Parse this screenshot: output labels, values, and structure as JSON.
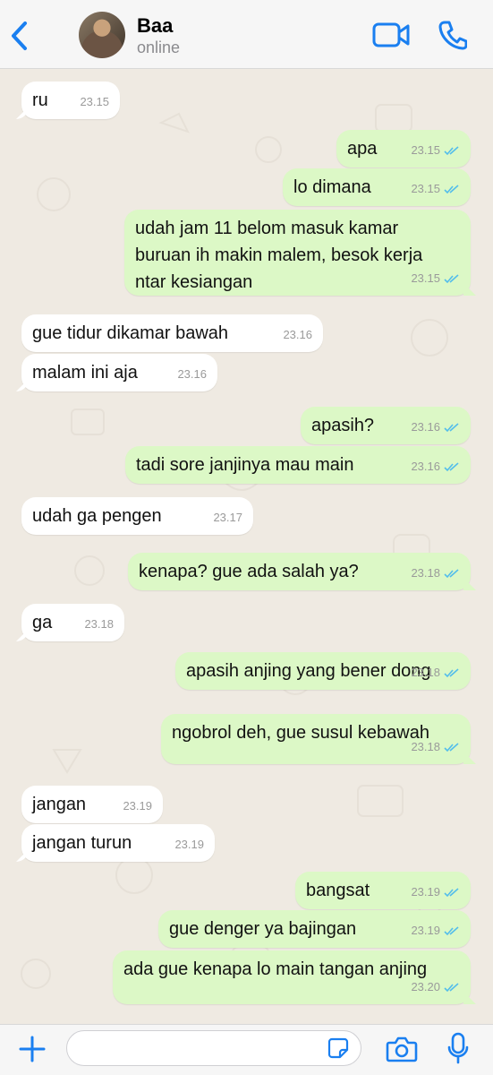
{
  "header": {
    "contact_name": "Baa",
    "status": "online"
  },
  "colors": {
    "accent": "#1a7ff0",
    "incoming_bubble": "#ffffff",
    "outgoing_bubble": "#dcf8c6",
    "chat_background": "#efeae2",
    "read_ticks": "#53bdeb"
  },
  "icons": {
    "back": "chevron-left-icon",
    "video": "video-camera-icon",
    "call": "phone-icon",
    "attach": "plus-icon",
    "sticker": "sticker-icon",
    "camera": "camera-icon",
    "mic": "microphone-icon"
  },
  "messages": [
    {
      "dir": "in",
      "text": "ru",
      "time": "23.15"
    },
    {
      "dir": "out",
      "text": "apa",
      "time": "23.15",
      "read": true
    },
    {
      "dir": "out",
      "text": "lo dimana",
      "time": "23.15",
      "read": true
    },
    {
      "dir": "out",
      "text": "udah jam 11 belom masuk kamar\nburuan ih makin malem, besok kerja\nntar kesiangan",
      "time": "23.15",
      "read": true
    },
    {
      "dir": "in",
      "text": "gue tidur dikamar bawah",
      "time": "23.16"
    },
    {
      "dir": "in",
      "text": "malam ini aja",
      "time": "23.16"
    },
    {
      "dir": "out",
      "text": "apasih?",
      "time": "23.16",
      "read": true
    },
    {
      "dir": "out",
      "text": "tadi sore janjinya mau main",
      "time": "23.16",
      "read": true
    },
    {
      "dir": "in",
      "text": "udah ga pengen",
      "time": "23.17"
    },
    {
      "dir": "out",
      "text": "kenapa? gue ada salah ya?",
      "time": "23.18",
      "read": true
    },
    {
      "dir": "in",
      "text": "ga",
      "time": "23.18"
    },
    {
      "dir": "out",
      "text": "apasih anjing yang bener dong",
      "time": "23.18",
      "read": true
    },
    {
      "dir": "out",
      "text": "ngobrol deh, gue susul kebawah",
      "time": "23.18",
      "read": true
    },
    {
      "dir": "in",
      "text": "jangan",
      "time": "23.19"
    },
    {
      "dir": "in",
      "text": "jangan turun",
      "time": "23.19"
    },
    {
      "dir": "out",
      "text": "bangsat",
      "time": "23.19",
      "read": true
    },
    {
      "dir": "out",
      "text": "gue denger ya bajingan",
      "time": "23.19",
      "read": true
    },
    {
      "dir": "out",
      "text": "ada gue kenapa lo main tangan anjing",
      "time": "23.20",
      "read": true
    }
  ],
  "composer": {
    "value": "",
    "placeholder": ""
  }
}
